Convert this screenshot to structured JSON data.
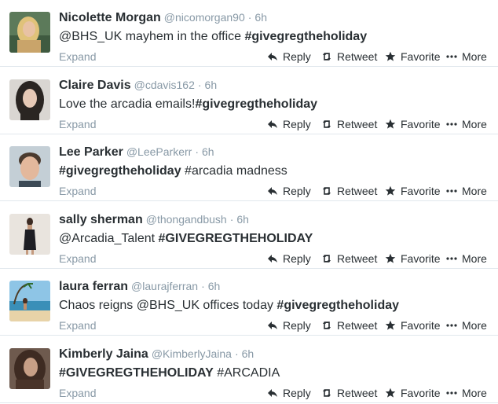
{
  "labels": {
    "expand": "Expand",
    "reply": "Reply",
    "retweet": "Retweet",
    "favorite": "Favorite",
    "more": "More",
    "dot": "·"
  },
  "tweets": [
    {
      "fullname": "Nicolette Morgan",
      "username": "@nicomorgan90",
      "time": "6h",
      "text_before": "@BHS_UK mayhem in the office ",
      "hashtag": "#givegregtheholiday",
      "text_after": "",
      "avatar": "avatar-blonde"
    },
    {
      "fullname": "Claire Davis",
      "username": "@cdavis162",
      "time": "6h",
      "text_before": "Love the arcadia emails!",
      "hashtag": "#givegregtheholiday",
      "text_after": "",
      "avatar": "avatar-dark-hair"
    },
    {
      "fullname": "Lee Parker",
      "username": "@LeeParkerr",
      "time": "6h",
      "text_before": "",
      "hashtag": "#givegregtheholiday",
      "text_after": " #arcadia madness",
      "avatar": "avatar-man"
    },
    {
      "fullname": "sally sherman",
      "username": "@thongandbush",
      "time": "6h",
      "text_before": "@Arcadia_Talent ",
      "hashtag": "#GIVEGREGTHEHOLIDAY",
      "text_after": "",
      "avatar": "avatar-dress"
    },
    {
      "fullname": "laura ferran",
      "username": "@laurajferran",
      "time": "6h",
      "text_before": "Chaos reigns @BHS_UK offices today ",
      "hashtag": "#givegregtheholiday",
      "text_after": "",
      "avatar": "avatar-beach"
    },
    {
      "fullname": "Kimberly Jaina",
      "username": "@KimberlyJaina",
      "time": "6h",
      "text_before": "",
      "hashtag": "#GIVEGREGTHEHOLIDAY",
      "text_after": " #ARCADIA",
      "avatar": "avatar-brunette"
    }
  ]
}
